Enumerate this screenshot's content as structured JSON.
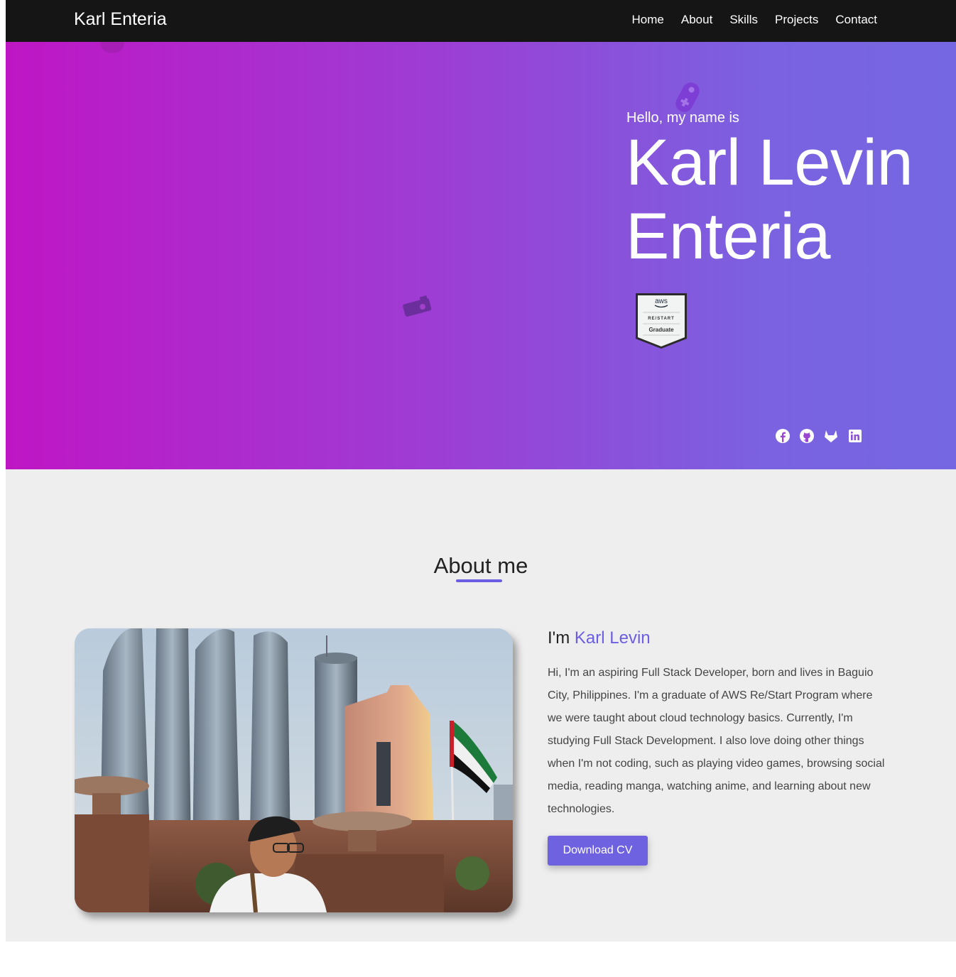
{
  "nav": {
    "brand": "Karl Enteria",
    "links": [
      "Home",
      "About",
      "Skills",
      "Projects",
      "Contact"
    ]
  },
  "hero": {
    "greeting": "Hello, my name is",
    "name_line1": "Karl Levin",
    "name_line2": "Enteria",
    "badge": {
      "logo": "aws",
      "line1": "RE/START",
      "line2": "Graduate"
    },
    "socials": [
      "facebook-icon",
      "github-icon",
      "gitlab-icon",
      "linkedin-icon"
    ],
    "decorative_icons": [
      "gamepad-icon",
      "camera-icon"
    ],
    "gradient": [
      "#bf16c4",
      "#7567e1"
    ]
  },
  "about": {
    "title": "About me",
    "intro_prefix": "I'm ",
    "intro_name": "Karl Levin",
    "bio": "Hi, I'm an aspiring Full Stack Developer, born and lives in Baguio City, Philippines. I'm a graduate of AWS Re/Start Program where we were taught about cloud technology basics. Currently, I'm studying Full Stack Development. I also love doing other things when I'm not coding, such as playing video games, browsing social media, reading manga, watching anime, and learning about new technologies.",
    "cv_button": "Download CV",
    "accent": "#6b5ee2"
  }
}
